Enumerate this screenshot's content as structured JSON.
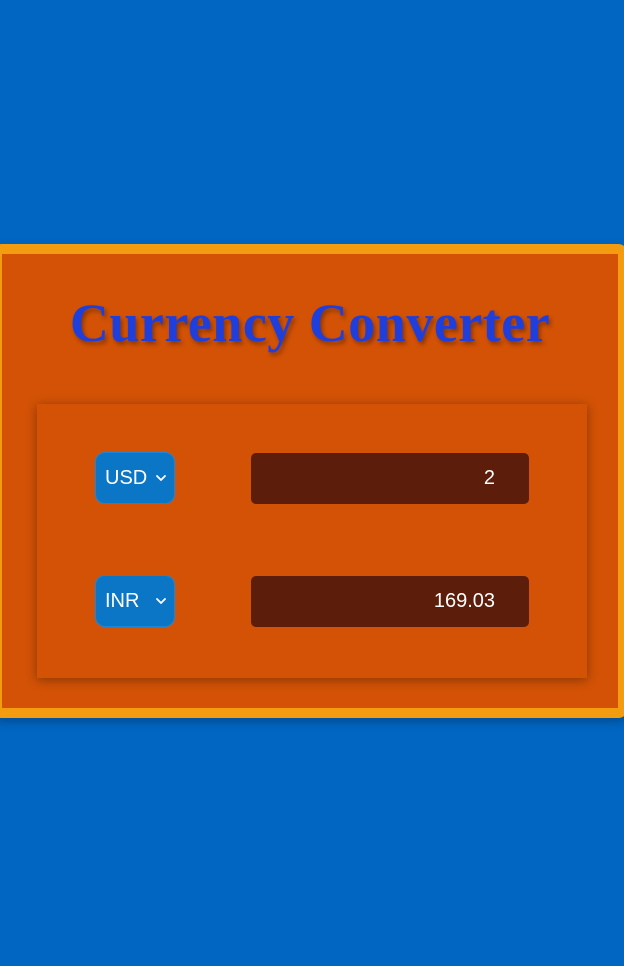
{
  "title": "Currency Converter",
  "from": {
    "currency": "USD",
    "amount": "2"
  },
  "to": {
    "currency": "INR",
    "amount": "169.03"
  },
  "colors": {
    "background": "#0066c2",
    "card": "#d35206",
    "card_border": "#f39c0f",
    "title": "#1f3fdc",
    "select": "#0b76c6",
    "input": "#5c1d0a"
  },
  "icons": {
    "dropdown": "chevron-down-icon"
  }
}
